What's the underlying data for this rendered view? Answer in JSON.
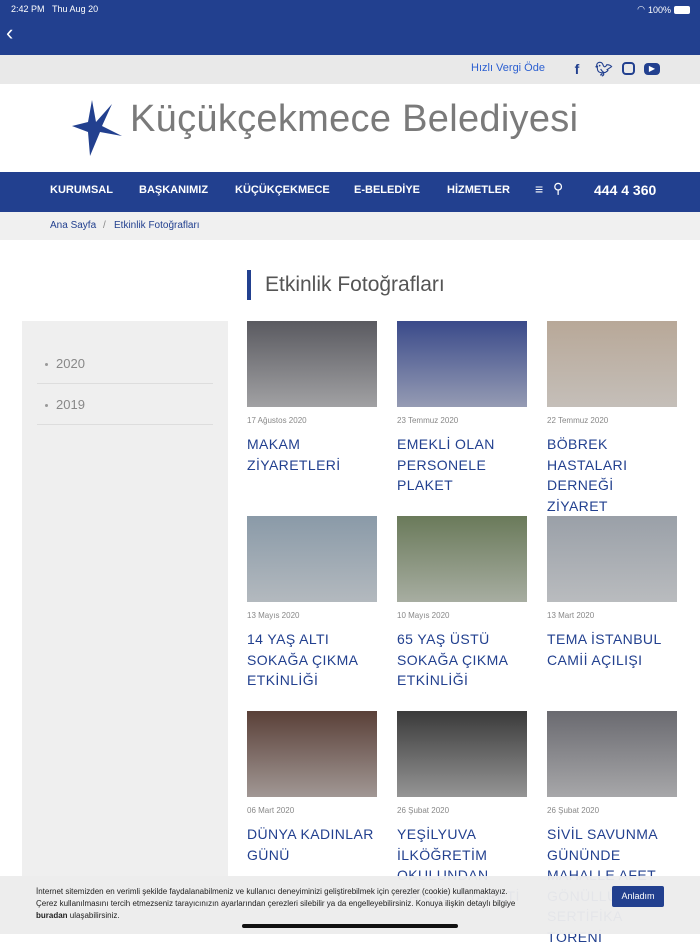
{
  "status": {
    "time": "2:42 PM",
    "date": "Thu Aug 20",
    "battery": "100%"
  },
  "topbar": {
    "vergi": "Hızlı Vergi Öde",
    "social": [
      "facebook-icon",
      "twitter-icon",
      "instagram-icon",
      "youtube-icon"
    ]
  },
  "header": {
    "title": "Küçükçekmece Belediyesi"
  },
  "nav": {
    "items": [
      "KURUMSAL",
      "BAŞKANIMIZ",
      "KÜÇÜKÇEKMECE",
      "E-BELEDİYE",
      "HİZMETLER"
    ],
    "phone": "444 4 360"
  },
  "breadcrumb": {
    "home": "Ana Sayfa",
    "sep": "/",
    "current": "Etkinlik Fotoğrafları"
  },
  "page": {
    "title": "Etkinlik Fotoğrafları"
  },
  "sidebar": {
    "years": [
      "2020",
      "2019"
    ]
  },
  "cards": [
    {
      "date": "17 Ağustos 2020",
      "title": "MAKAM ZİYARETLERİ",
      "color": "#5a5a60"
    },
    {
      "date": "23 Temmuz 2020",
      "title": "EMEKLİ OLAN PERSONELE PLAKET",
      "color": "#3a4a8a"
    },
    {
      "date": "22 Temmuz 2020",
      "title": "BÖBREK HASTALARI DERNEĞİ ZİYARET",
      "color": "#b8a898"
    },
    {
      "date": "13 Mayıs 2020",
      "title": "14 YAŞ ALTI SOKAĞA ÇIKMA ETKİNLİĞİ",
      "color": "#8a9aa8"
    },
    {
      "date": "10 Mayıs 2020",
      "title": "65 YAŞ ÜSTÜ SOKAĞA ÇIKMA ETKİNLİĞİ",
      "color": "#6a7a5a"
    },
    {
      "date": "13 Mart 2020",
      "title": "TEMA İSTANBUL CAMİİ AÇILIŞI",
      "color": "#9aa0a8"
    },
    {
      "date": "06 Mart 2020",
      "title": "DÜNYA KADINLAR GÜNÜ",
      "color": "#5a4038"
    },
    {
      "date": "26 Şubat 2020",
      "title": "YEŞİLYUVA İLKÖĞRETİM OKULUNDAN MAKAM ZİYARETİ",
      "color": "#3a3a3a"
    },
    {
      "date": "26 Şubat 2020",
      "title": "SİVİL SAVUNMA GÜNÜNDE MAHALLE AFET GÖNÜLLÜ SERTİFİKA TÖRENİ",
      "color": "#6a6a70"
    }
  ],
  "cookie": {
    "text1": "İnternet sitemizden en verimli şekilde faydalanabilmeniz ve kullanıcı deneyiminizi geliştirebilmek için çerezler (cookie) kullanmaktayız.",
    "text2": "Çerez kullanılmasını tercih etmezseniz tarayıcınızın ayarlarından çerezleri silebilir ya da engelleyebilirsiniz. Konuya ilişkin detaylı bilgiye",
    "link": "buradan",
    "text3": " ulaşabilirsiniz.",
    "button": "Anladım"
  }
}
